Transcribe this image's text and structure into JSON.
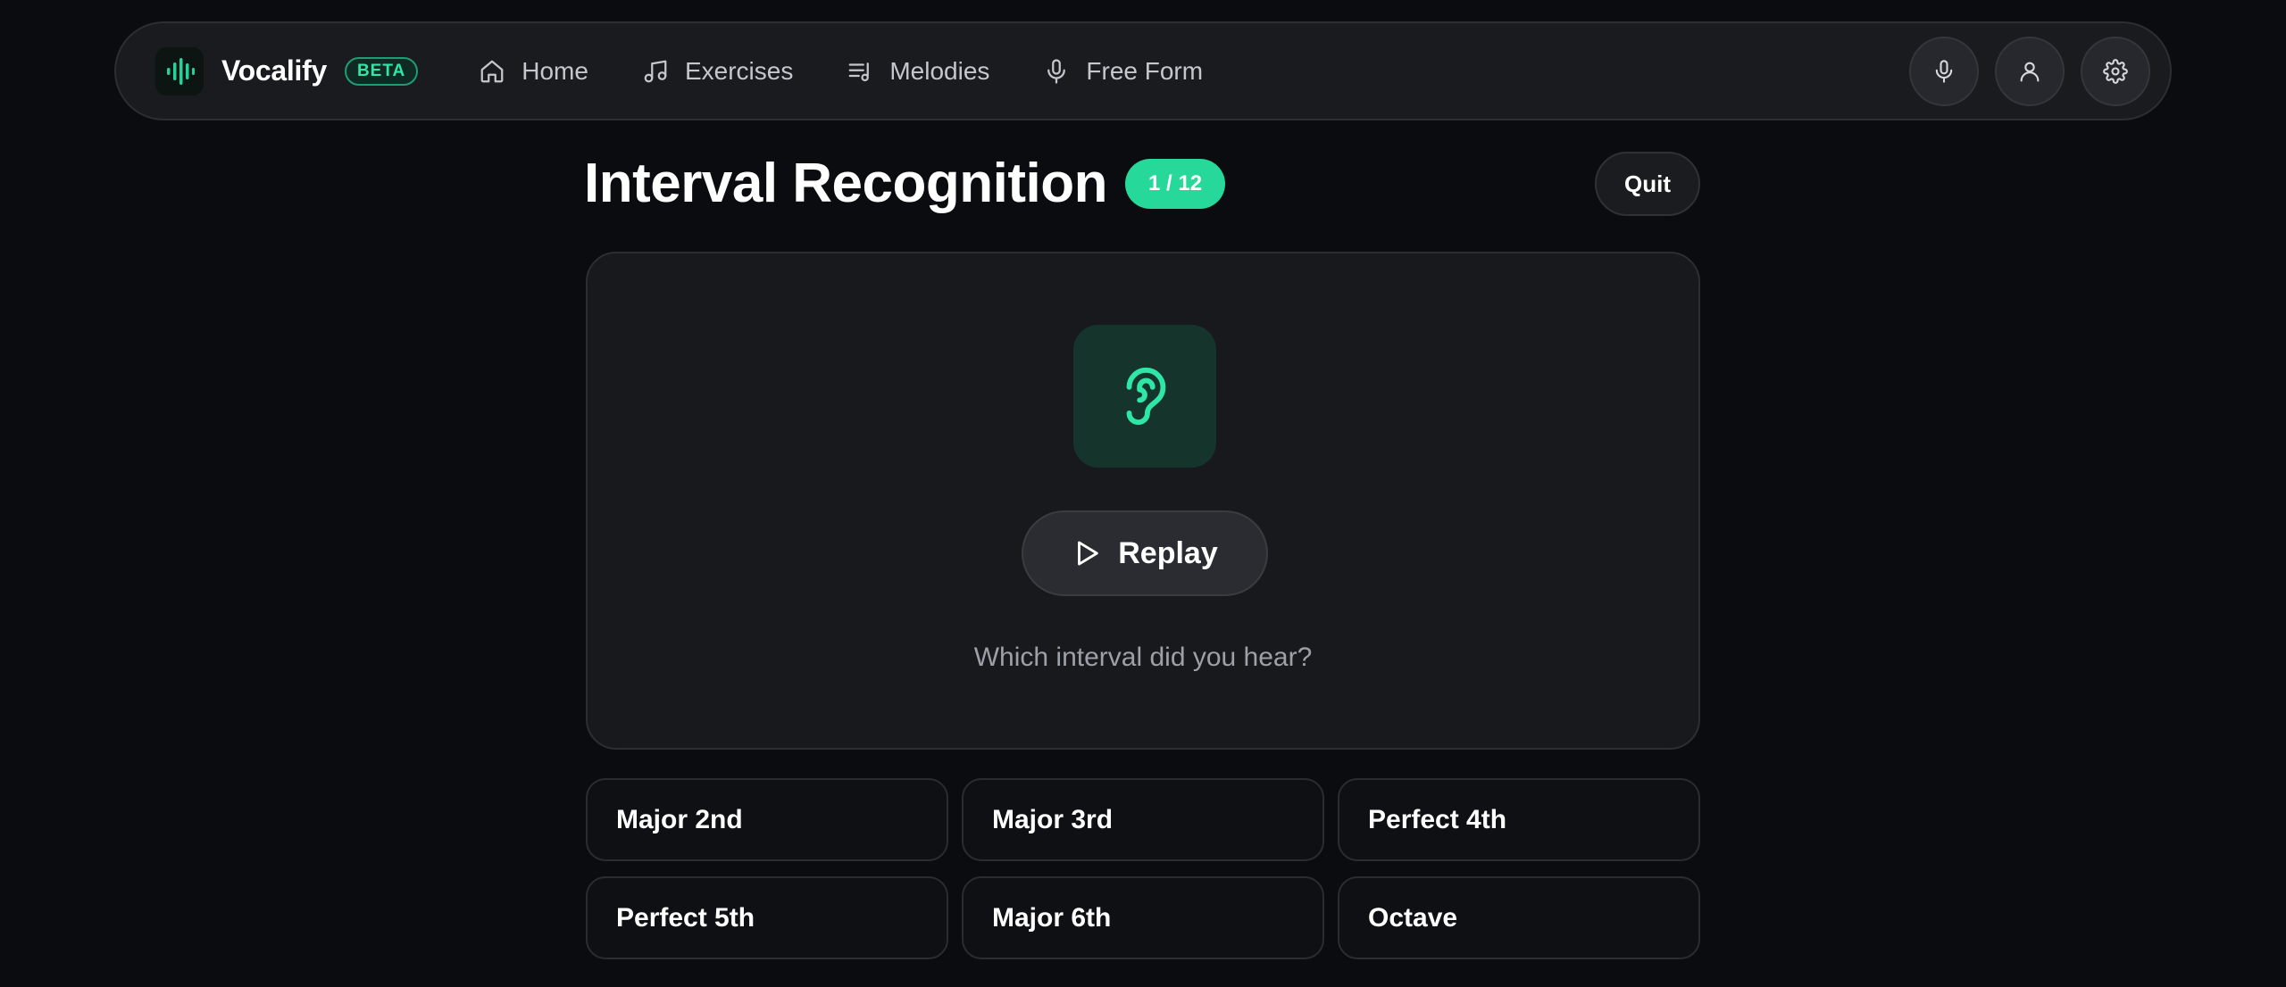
{
  "brand": {
    "name": "Vocalify",
    "badge": "BETA",
    "logo_icon": "waveform-icon"
  },
  "nav": [
    {
      "label": "Home",
      "icon": "home-icon"
    },
    {
      "label": "Exercises",
      "icon": "music-note-icon"
    },
    {
      "label": "Melodies",
      "icon": "list-music-icon"
    },
    {
      "label": "Free Form",
      "icon": "microphone-icon"
    }
  ],
  "actions": [
    {
      "icon": "microphone-icon"
    },
    {
      "icon": "user-icon"
    },
    {
      "icon": "gear-icon"
    }
  ],
  "exercise": {
    "title": "Interval Recognition",
    "progress": "1 / 12",
    "quit_label": "Quit",
    "replay_label": "Replay",
    "question": "Which interval did you hear?"
  },
  "answers": [
    "Major 2nd",
    "Major 3rd",
    "Perfect 4th",
    "Perfect 5th",
    "Major 6th",
    "Octave"
  ],
  "colors": {
    "accent": "#26d99a",
    "background": "#0b0c0f",
    "card": "#18191d"
  }
}
